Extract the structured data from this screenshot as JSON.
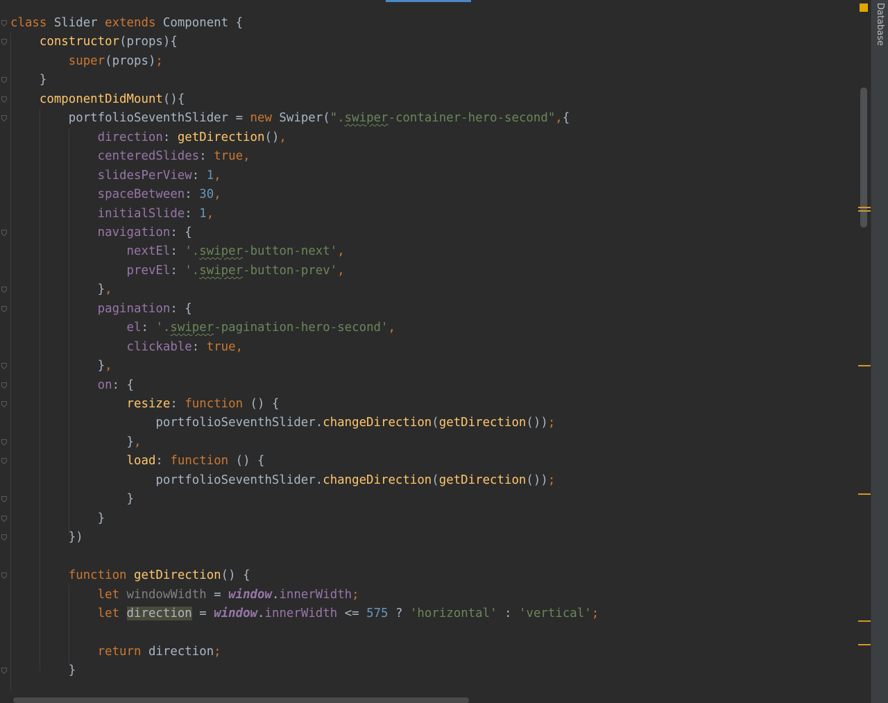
{
  "sidebar": {
    "database_label": "Database"
  },
  "colors": {
    "background": "#2b2b2b",
    "keyword": "#cc7832",
    "function": "#ffc66d",
    "property": "#9876aa",
    "string": "#6a8759",
    "number": "#6897bb",
    "text": "#a9b7c6",
    "marker": "#d19a2a"
  },
  "code": {
    "lines": [
      [
        [
          "kw",
          "class"
        ],
        [
          "plain",
          " Slider "
        ],
        [
          "kw",
          "extends"
        ],
        [
          "plain",
          " Component {"
        ]
      ],
      [
        [
          "plain",
          "    "
        ],
        [
          "fn",
          "constructor"
        ],
        [
          "plain",
          "(props){"
        ]
      ],
      [
        [
          "plain",
          "        "
        ],
        [
          "kw",
          "super"
        ],
        [
          "plain",
          "(props)"
        ],
        [
          "punc",
          ";"
        ]
      ],
      [
        [
          "plain",
          "    }"
        ]
      ],
      [
        [
          "plain",
          "    "
        ],
        [
          "fn",
          "componentDidMount"
        ],
        [
          "plain",
          "(){"
        ]
      ],
      [
        [
          "plain",
          "        portfolioSeventhSlider = "
        ],
        [
          "kw",
          "new"
        ],
        [
          "plain",
          " Swiper("
        ],
        [
          "str",
          "\"."
        ],
        [
          "strtypo",
          "swiper"
        ],
        [
          "str",
          "-container-hero-second\""
        ],
        [
          "punc",
          ","
        ],
        [
          "plain",
          "{"
        ]
      ],
      [
        [
          "plain",
          "            "
        ],
        [
          "prop",
          "direction"
        ],
        [
          "plain",
          ": "
        ],
        [
          "fn",
          "getDirection"
        ],
        [
          "plain",
          "()"
        ],
        [
          "punc",
          ","
        ]
      ],
      [
        [
          "plain",
          "            "
        ],
        [
          "prop",
          "centeredSlides"
        ],
        [
          "plain",
          ": "
        ],
        [
          "kw",
          "true"
        ],
        [
          "punc",
          ","
        ]
      ],
      [
        [
          "plain",
          "            "
        ],
        [
          "prop",
          "slidesPerView"
        ],
        [
          "plain",
          ": "
        ],
        [
          "num",
          "1"
        ],
        [
          "punc",
          ","
        ]
      ],
      [
        [
          "plain",
          "            "
        ],
        [
          "prop",
          "spaceBetween"
        ],
        [
          "plain",
          ": "
        ],
        [
          "num",
          "30"
        ],
        [
          "punc",
          ","
        ]
      ],
      [
        [
          "plain",
          "            "
        ],
        [
          "prop",
          "initialSlide"
        ],
        [
          "plain",
          ": "
        ],
        [
          "num",
          "1"
        ],
        [
          "punc",
          ","
        ]
      ],
      [
        [
          "plain",
          "            "
        ],
        [
          "prop",
          "navigation"
        ],
        [
          "plain",
          ": {"
        ]
      ],
      [
        [
          "plain",
          "                "
        ],
        [
          "prop",
          "nextEl"
        ],
        [
          "plain",
          ": "
        ],
        [
          "str",
          "'."
        ],
        [
          "strtypo",
          "swiper"
        ],
        [
          "str",
          "-button-next'"
        ],
        [
          "punc",
          ","
        ]
      ],
      [
        [
          "plain",
          "                "
        ],
        [
          "prop",
          "prevEl"
        ],
        [
          "plain",
          ": "
        ],
        [
          "str",
          "'."
        ],
        [
          "strtypo",
          "swiper"
        ],
        [
          "str",
          "-button-prev'"
        ],
        [
          "punc",
          ","
        ]
      ],
      [
        [
          "plain",
          "            }"
        ],
        [
          "punc",
          ","
        ]
      ],
      [
        [
          "plain",
          "            "
        ],
        [
          "prop",
          "pagination"
        ],
        [
          "plain",
          ": {"
        ]
      ],
      [
        [
          "plain",
          "                "
        ],
        [
          "prop",
          "el"
        ],
        [
          "plain",
          ": "
        ],
        [
          "str",
          "'."
        ],
        [
          "strtypo",
          "swiper"
        ],
        [
          "str",
          "-pagination-hero-second'"
        ],
        [
          "punc",
          ","
        ]
      ],
      [
        [
          "plain",
          "                "
        ],
        [
          "prop",
          "clickable"
        ],
        [
          "plain",
          ": "
        ],
        [
          "kw",
          "true"
        ],
        [
          "punc",
          ","
        ]
      ],
      [
        [
          "plain",
          "            }"
        ],
        [
          "punc",
          ","
        ]
      ],
      [
        [
          "plain",
          "            "
        ],
        [
          "prop",
          "on"
        ],
        [
          "plain",
          ": {"
        ]
      ],
      [
        [
          "plain",
          "                "
        ],
        [
          "fn",
          "resize"
        ],
        [
          "plain",
          ": "
        ],
        [
          "kw",
          "function"
        ],
        [
          "plain",
          " () {"
        ]
      ],
      [
        [
          "plain",
          "                    portfolioSeventhSlider."
        ],
        [
          "fn",
          "changeDirection"
        ],
        [
          "plain",
          "("
        ],
        [
          "fn",
          "getDirection"
        ],
        [
          "plain",
          "())"
        ],
        [
          "punc",
          ";"
        ]
      ],
      [
        [
          "plain",
          "                }"
        ],
        [
          "punc",
          ","
        ]
      ],
      [
        [
          "plain",
          "                "
        ],
        [
          "fn",
          "load"
        ],
        [
          "plain",
          ": "
        ],
        [
          "kw",
          "function"
        ],
        [
          "plain",
          " () {"
        ]
      ],
      [
        [
          "plain",
          "                    portfolioSeventhSlider."
        ],
        [
          "fn",
          "changeDirection"
        ],
        [
          "plain",
          "("
        ],
        [
          "fn",
          "getDirection"
        ],
        [
          "plain",
          "())"
        ],
        [
          "punc",
          ";"
        ]
      ],
      [
        [
          "plain",
          "                }"
        ]
      ],
      [
        [
          "plain",
          "            }"
        ]
      ],
      [
        [
          "plain",
          "        })"
        ]
      ],
      [
        [
          "plain",
          ""
        ]
      ],
      [
        [
          "plain",
          "        "
        ],
        [
          "kw",
          "function"
        ],
        [
          "plain",
          " "
        ],
        [
          "fn",
          "getDirection"
        ],
        [
          "plain",
          "() {"
        ]
      ],
      [
        [
          "plain",
          "            "
        ],
        [
          "kw",
          "let"
        ],
        [
          "plain",
          " "
        ],
        [
          "unused",
          "windowWidth"
        ],
        [
          "plain",
          " = "
        ],
        [
          "glob",
          "window"
        ],
        [
          "plain",
          "."
        ],
        [
          "prop",
          "innerWidth"
        ],
        [
          "punc",
          ";"
        ]
      ],
      [
        [
          "plain",
          "            "
        ],
        [
          "kw",
          "let"
        ],
        [
          "plain",
          " "
        ],
        [
          "hl",
          "direction"
        ],
        [
          "plain",
          " = "
        ],
        [
          "glob",
          "window"
        ],
        [
          "plain",
          "."
        ],
        [
          "prop",
          "innerWidth"
        ],
        [
          "plain",
          " <= "
        ],
        [
          "num",
          "575"
        ],
        [
          "plain",
          " ? "
        ],
        [
          "str",
          "'horizontal'"
        ],
        [
          "plain",
          " : "
        ],
        [
          "str",
          "'vertical'"
        ],
        [
          "punc",
          ";"
        ]
      ],
      [
        [
          "plain",
          ""
        ]
      ],
      [
        [
          "plain",
          "            "
        ],
        [
          "kw",
          "return"
        ],
        [
          "plain",
          " direction"
        ],
        [
          "punc",
          ";"
        ]
      ],
      [
        [
          "plain",
          "        }"
        ]
      ]
    ]
  }
}
